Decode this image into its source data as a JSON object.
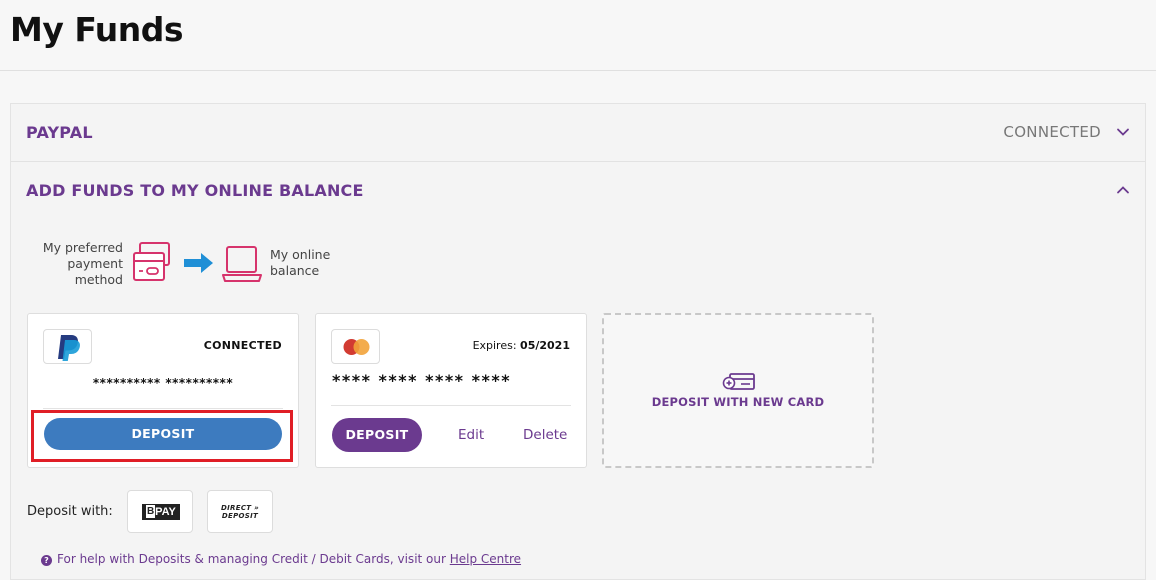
{
  "page": {
    "title": "My Funds"
  },
  "accordion": {
    "paypal": {
      "title": "PAYPAL",
      "status": "CONNECTED",
      "chevron": "chevron-down-icon"
    },
    "add_funds": {
      "title": "ADD FUNDS TO MY ONLINE BALANCE",
      "chevron": "chevron-up-icon"
    }
  },
  "flow": {
    "from_label": "My preferred payment method",
    "to_label": "My online balance"
  },
  "paypal_card": {
    "status": "CONNECTED",
    "masked_account": "********** **********",
    "deposit_label": "DEPOSIT"
  },
  "master_card": {
    "expires_label": "Expires:",
    "expires_value": "05/2021",
    "masked_number": "**** **** **** ****",
    "deposit_label": "DEPOSIT",
    "edit_label": "Edit",
    "delete_label": "Delete"
  },
  "new_card": {
    "label": "DEPOSIT WITH NEW CARD"
  },
  "deposit_with": {
    "label": "Deposit with:",
    "bpay": {
      "b": "B",
      "text": "PAY"
    },
    "direct": {
      "line1": "DIRECT »",
      "line2": "DEPOSIT"
    }
  },
  "help": {
    "icon": "?",
    "text": "For help with Deposits & managing Credit / Debit Cards, visit our ",
    "link": "Help Centre"
  },
  "colors": {
    "brand_purple": "#6b3a8f",
    "paypal_blue": "#3d7bbf",
    "highlight_red": "#e01e26",
    "icon_pink": "#d6336c",
    "arrow_blue": "#1f8fd6"
  }
}
